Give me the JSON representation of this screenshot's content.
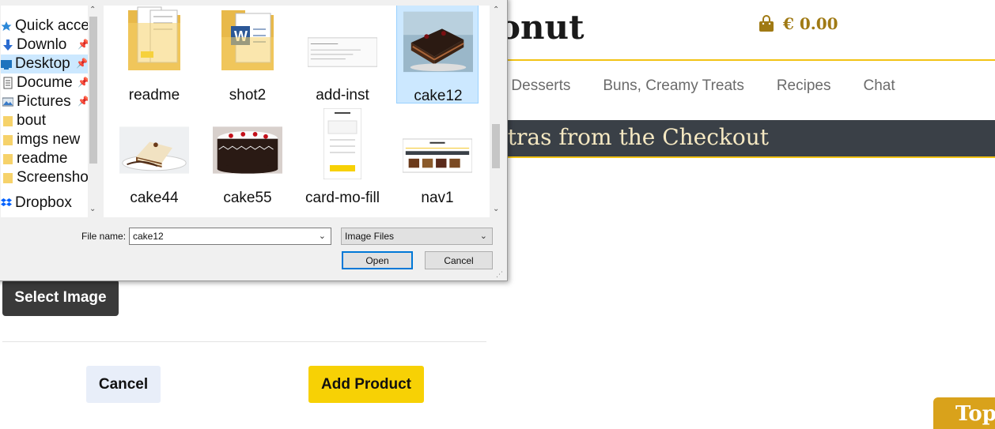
{
  "header": {
    "logo_text": "onut",
    "cart_amount": "€ 0.00"
  },
  "nav": {
    "items": [
      "nd Desserts",
      "Buns, Creamy Treats",
      "Recipes",
      "Chat"
    ]
  },
  "banner": {
    "text": "xtras from the Checkout"
  },
  "form": {
    "select_image_label": "Select Image",
    "cancel_label": "Cancel",
    "add_product_label": "Add Product"
  },
  "floating": {
    "top_label": "Top"
  },
  "colors": {
    "accent_gold": "#f2c314",
    "banner_bg": "#3a4047",
    "add_button": "#f7d105",
    "selection": "#cce8ff"
  },
  "dialog": {
    "nav_pane": [
      {
        "label": "Quick acce",
        "icon": "star-icon",
        "pinned": false
      },
      {
        "label": "Downlo",
        "icon": "download-arrow-icon",
        "pinned": true
      },
      {
        "label": "Desktop",
        "icon": "desktop-icon",
        "pinned": true,
        "selected": true
      },
      {
        "label": "Docume",
        "icon": "document-icon",
        "pinned": true
      },
      {
        "label": "Pictures",
        "icon": "pictures-icon",
        "pinned": true
      },
      {
        "label": "bout",
        "icon": "folder-icon",
        "pinned": false
      },
      {
        "label": "imgs new",
        "icon": "folder-icon",
        "pinned": false
      },
      {
        "label": "readme",
        "icon": "folder-icon",
        "pinned": false
      },
      {
        "label": "Screensho",
        "icon": "folder-icon",
        "pinned": false
      },
      {
        "label": "Dropbox",
        "icon": "dropbox-icon",
        "pinned": false
      }
    ],
    "files": [
      {
        "name": "readme",
        "type": "folder"
      },
      {
        "name": "shot2",
        "type": "word-folder"
      },
      {
        "name": "add-inst",
        "type": "screenshot"
      },
      {
        "name": "cake12",
        "type": "image",
        "selected": true
      },
      {
        "name": "cake44",
        "type": "image"
      },
      {
        "name": "cake55",
        "type": "image"
      },
      {
        "name": "card-mo-fill",
        "type": "screenshot"
      },
      {
        "name": "nav1",
        "type": "screenshot"
      }
    ],
    "filename_label": "File name:",
    "filename_value": "cake12",
    "filetype_value": "Image Files",
    "open_label": "Open",
    "cancel_label": "Cancel"
  }
}
